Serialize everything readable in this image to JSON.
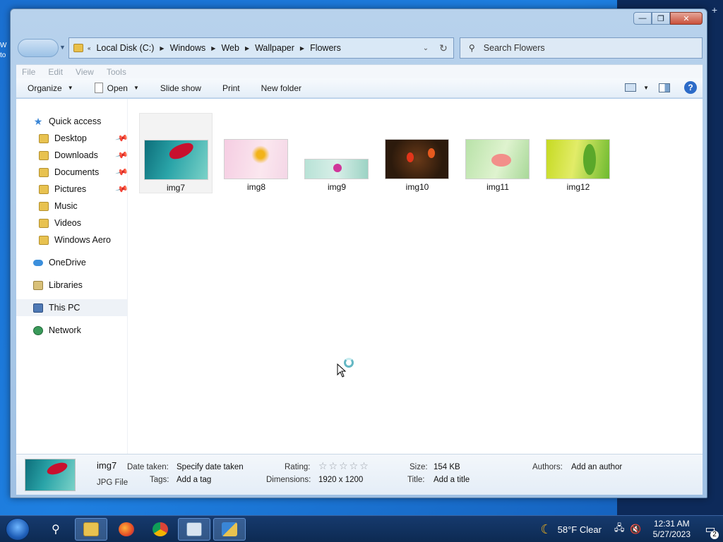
{
  "desktop": {
    "stub_text": "W to"
  },
  "window": {
    "caption": {
      "minimize": "—",
      "maximize": "❐",
      "close": "✕"
    }
  },
  "address": {
    "overflow": "«",
    "crumbs": [
      "Local Disk (C:)",
      "Windows",
      "Web",
      "Wallpaper",
      "Flowers"
    ],
    "refresh_glyph": "↻",
    "dropdown_glyph": "⌄"
  },
  "search": {
    "placeholder": "Search Flowers"
  },
  "menubar": {
    "items": [
      "File",
      "Edit",
      "View",
      "Tools"
    ]
  },
  "toolbar": {
    "organize": "Organize",
    "open": "Open",
    "slideshow": "Slide show",
    "print": "Print",
    "new_folder": "New folder",
    "help": "?"
  },
  "nav": {
    "quick_access": "Quick access",
    "quick_items": [
      {
        "label": "Desktop",
        "pinned": true
      },
      {
        "label": "Downloads",
        "pinned": true
      },
      {
        "label": "Documents",
        "pinned": true
      },
      {
        "label": "Pictures",
        "pinned": true
      },
      {
        "label": "Music",
        "pinned": false
      },
      {
        "label": "Videos",
        "pinned": false
      },
      {
        "label": "Windows Aero",
        "pinned": false
      }
    ],
    "onedrive": "OneDrive",
    "libraries": "Libraries",
    "this_pc": "This PC",
    "network": "Network"
  },
  "files": [
    {
      "name": "img7",
      "selected": true
    },
    {
      "name": "img8",
      "selected": false
    },
    {
      "name": "img9",
      "selected": false
    },
    {
      "name": "img10",
      "selected": false
    },
    {
      "name": "img11",
      "selected": false
    },
    {
      "name": "img12",
      "selected": false
    }
  ],
  "details": {
    "name": "img7",
    "type": "JPG File",
    "date_taken_label": "Date taken:",
    "date_taken_value": "Specify date taken",
    "tags_label": "Tags:",
    "tags_value": "Add a tag",
    "rating_label": "Rating:",
    "rating_stars": "☆☆☆☆☆",
    "dimensions_label": "Dimensions:",
    "dimensions_value": "1920 x 1200",
    "size_label": "Size:",
    "size_value": "154 KB",
    "title_label": "Title:",
    "title_value": "Add a title",
    "authors_label": "Authors:",
    "authors_value": "Add an author"
  },
  "taskbar": {
    "weather": "58°F  Clear",
    "time": "12:31 AM",
    "date": "5/27/2023",
    "notifications": "2"
  }
}
